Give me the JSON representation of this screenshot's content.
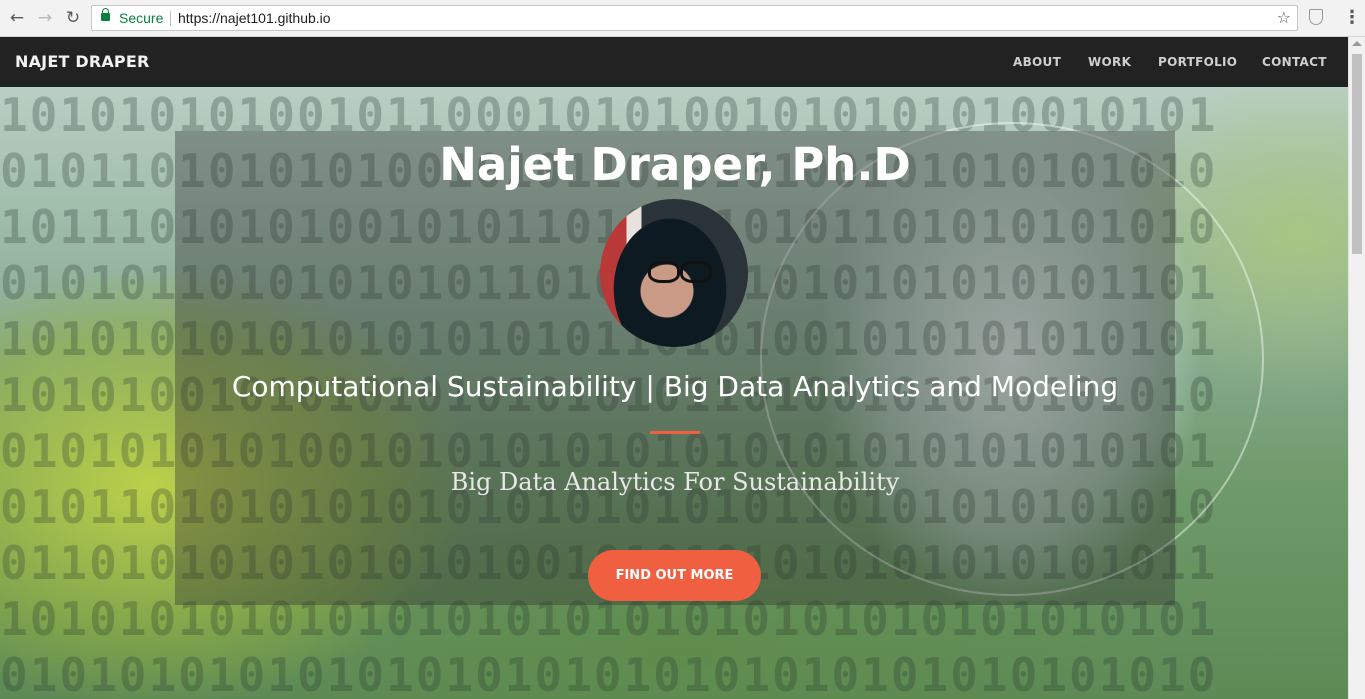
{
  "browser": {
    "back_icon": "←",
    "forward_icon": "→",
    "reload_icon": "↻",
    "security_label": "Secure",
    "url": "https://najet101.github.io",
    "star_icon": "☆",
    "menu_icon": "⋮"
  },
  "site_nav": {
    "brand": "NAJET DRAPER",
    "links": [
      "ABOUT",
      "WORK",
      "PORTFOLIO",
      "CONTACT"
    ]
  },
  "hero": {
    "binary_rows": [
      "10101010100101100010101001010101010010101",
      "01011010101010010101101010100101010101010",
      "10111010101001010110101010101101010101010",
      "01010110101010101101010101010101010101101",
      "10101010101010101010110101001010101010101",
      "10101001010101010101010110100101010101010",
      "01010101010010101010101010101010101010101",
      "01011010101010101010101010110101010101010",
      "01101010101010101001010101010101010101011",
      "10101010101010101010101010101010101010101",
      "01010101010101010101010101010101010101010"
    ],
    "title": "Najet Draper, Ph.D",
    "subtitle": "Computational Sustainability | Big Data Analytics and Modeling",
    "tagline": "Big Data Analytics For Sustainability",
    "cta_label": "FIND OUT MORE"
  },
  "colors": {
    "accent": "#f05f40",
    "navbar": "#222222",
    "secure_green": "#0b8043"
  }
}
